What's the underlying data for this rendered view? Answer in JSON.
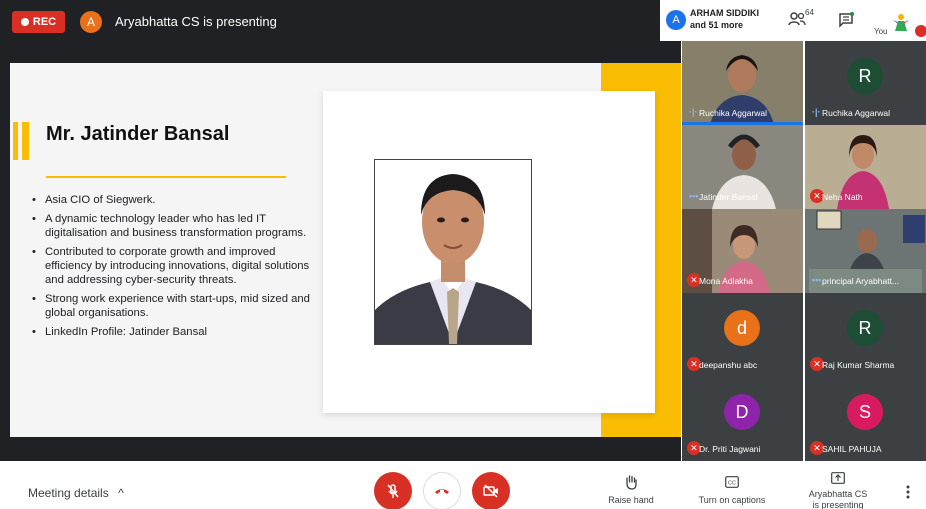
{
  "topbar": {
    "rec_label": "REC",
    "presenter_initial": "A",
    "presenting_text": "Aryabhatta CS is presenting",
    "participant_initial": "A",
    "participant_name": "ARHAM SIDDIKI",
    "participant_more": "and 51 more",
    "people_count": "64",
    "self_label": "You"
  },
  "slide": {
    "title": "Mr. Jatinder Bansal",
    "bullets": [
      "Asia CIO of Siegwerk.",
      "A dynamic technology leader who has led IT digitalisation and business transformation programs.",
      "Contributed to corporate growth and improved efficiency by introducing innovations, digital solutions and addressing cyber-security threats.",
      "Strong work experience with start-ups, mid sized and global organisations.",
      "LinkedIn Profile: Jatinder Bansal"
    ]
  },
  "tiles": [
    {
      "name": "Ruchika Aggarwal",
      "type": "video",
      "audio": "active"
    },
    {
      "name": "Ruchika Aggarwal",
      "type": "initial",
      "initial": "R",
      "color": "#1e4d35",
      "audio": "active"
    },
    {
      "name": "Jatinder Bansal",
      "type": "video",
      "audio": "dots"
    },
    {
      "name": "Neha Nath",
      "type": "video",
      "audio": "muted"
    },
    {
      "name": "Mona Adlakha",
      "type": "video",
      "audio": "muted"
    },
    {
      "name": "principal Aryabhatt...",
      "type": "video",
      "audio": "dots"
    },
    {
      "name": "deepanshu abc",
      "type": "initial",
      "initial": "d",
      "color": "#e8711a",
      "audio": "muted"
    },
    {
      "name": "Raj Kumar Sharma",
      "type": "initial",
      "initial": "R",
      "color": "#1e4d35",
      "audio": "muted"
    },
    {
      "name": "Dr. Priti Jagwani",
      "type": "initial",
      "initial": "D",
      "color": "#8e24aa",
      "audio": "muted"
    },
    {
      "name": "SAHIL PAHUJA",
      "type": "initial",
      "initial": "S",
      "color": "#d81b60",
      "audio": "muted"
    }
  ],
  "bottombar": {
    "meeting_details": "Meeting details",
    "raise_hand": "Raise hand",
    "captions": "Turn on captions",
    "presenting_line1": "Aryabhatta CS",
    "presenting_line2": "is presenting"
  },
  "colors": {
    "accent_yellow": "#fbbc04",
    "record_red": "#d93025",
    "meet_blue": "#1a73e8",
    "dark_bg": "#202124"
  }
}
